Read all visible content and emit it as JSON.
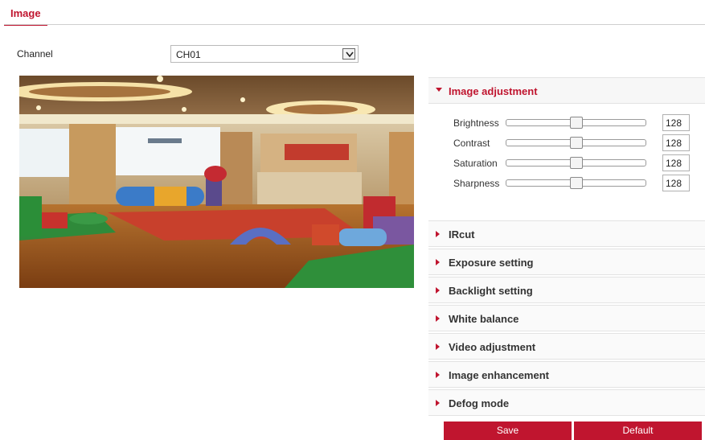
{
  "tab": {
    "label": "Image"
  },
  "channel": {
    "label": "Channel",
    "value": "CH01"
  },
  "image_adjustment": {
    "title": "Image adjustment",
    "sliders": [
      {
        "label": "Brightness",
        "value": "128",
        "level": 0.5
      },
      {
        "label": "Contrast",
        "value": "128",
        "level": 0.5
      },
      {
        "label": "Saturation",
        "value": "128",
        "level": 0.5
      },
      {
        "label": "Sharpness",
        "value": "128",
        "level": 0.5
      }
    ]
  },
  "sections": [
    {
      "title": "IRcut"
    },
    {
      "title": "Exposure setting"
    },
    {
      "title": "Backlight setting"
    },
    {
      "title": "White balance"
    },
    {
      "title": "Video adjustment"
    },
    {
      "title": "Image enhancement"
    },
    {
      "title": "Defog mode"
    }
  ],
  "buttons": {
    "save": "Save",
    "default": "Default"
  },
  "colors": {
    "accent": "#c0152f"
  }
}
